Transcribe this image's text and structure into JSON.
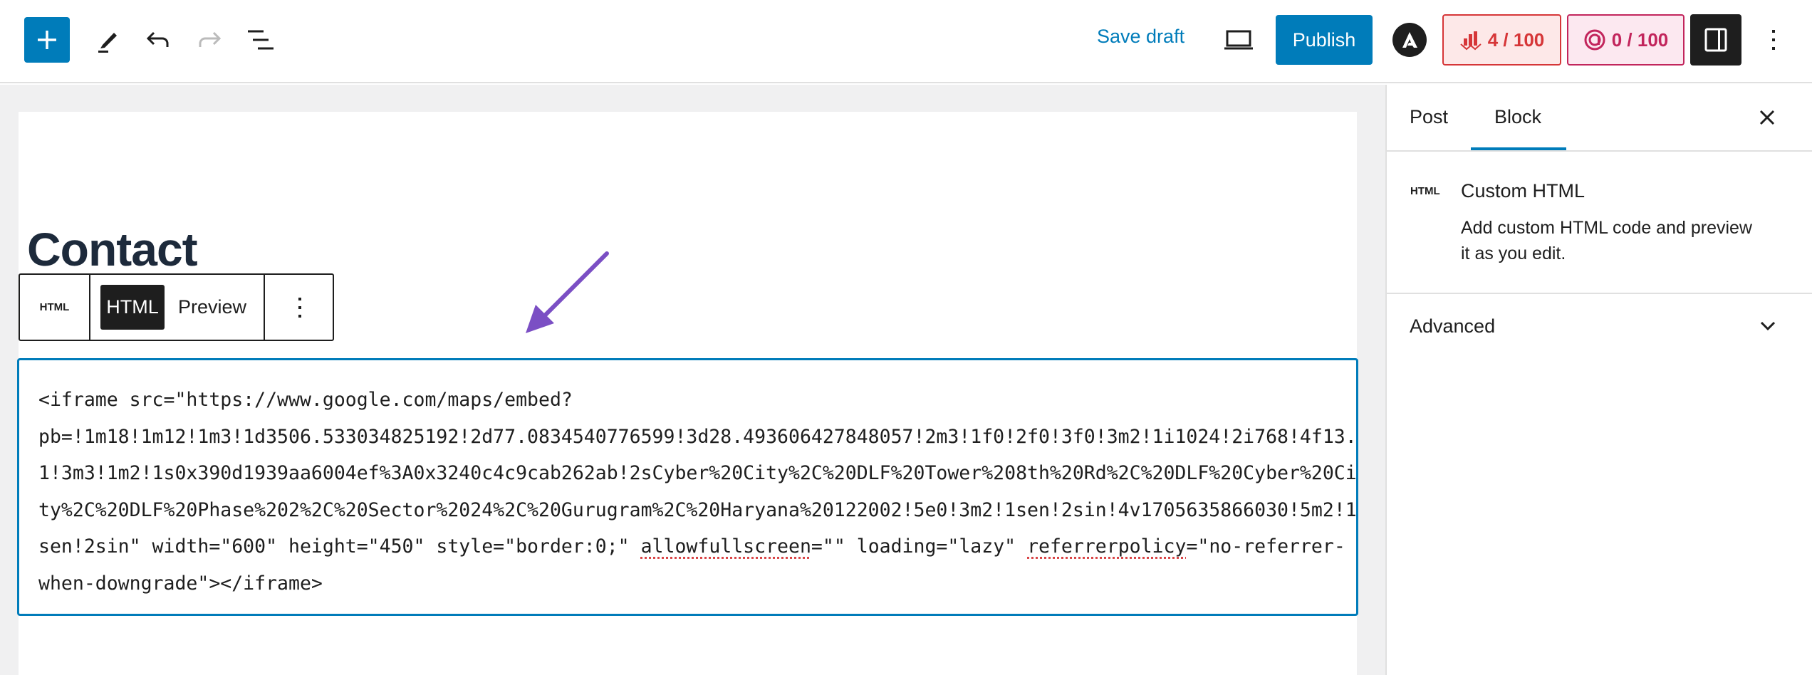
{
  "topbar": {
    "save_draft": "Save draft",
    "publish": "Publish",
    "seo_score": "4 / 100",
    "ai_score": "0 / 100",
    "icons": [
      "plus-icon",
      "pencil-icon",
      "undo-icon",
      "redo-icon",
      "list-view-icon",
      "laptop-preview-icon",
      "astra-logo-icon",
      "seo-chart-icon",
      "ai-icon",
      "sidebar-toggle-icon",
      "more-vertical-icon"
    ],
    "colors": {
      "accent": "#007cba",
      "seo": "#d63638",
      "ai": "#c2255c"
    }
  },
  "editor": {
    "title": "Contact",
    "toolbar": {
      "block_icon": "HTML",
      "html_tab": "HTML",
      "preview_tab": "Preview"
    },
    "code_lines": [
      "<iframe src=\"https://www.google.com/maps/embed?",
      "pb=!1m18!1m12!1m3!1d3506.533034825192!2d77.0834540776599!3d28.493606427848057!2m3!1f0!2f0!3f0!3m2!1i1024!2i768!4f13.",
      "1!3m3!1m2!1s0x390d1939aa6004ef%3A0x3240c4c9cab262ab!2sCyber%20City%2C%20DLF%20Tower%208th%20Rd%2C%20DLF%20Cyber%20Ci",
      "ty%2C%20DLF%20Phase%202%2C%20Sector%2024%2C%20Gurugram%2C%20Haryana%20122002!5e0!3m2!1sen!2sin!4v1705635866030!5m2!1",
      "sen!2sin\" width=\"600\" height=\"450\" style=\"border:0;\" ",
      "allowfullscreen",
      "=\"\" loading=\"lazy\" ",
      "referrerpolicy",
      "=\"no-referrer-",
      "when-downgrade\"></iframe>"
    ]
  },
  "sidebar": {
    "tabs": [
      {
        "label": "Post"
      },
      {
        "label": "Block",
        "active": true
      }
    ],
    "block_icon": "HTML",
    "block_name": "Custom HTML",
    "block_desc_1": "Add custom HTML code and preview",
    "block_desc_2": "it as you edit.",
    "advanced": "Advanced"
  },
  "annotation": {
    "arrow_color": "#7b4fc4"
  }
}
